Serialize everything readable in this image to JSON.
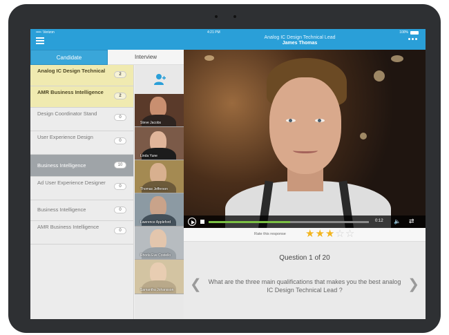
{
  "status": {
    "carrier": "••••◦ Verizon",
    "time": "4:21 PM",
    "battery": "100%"
  },
  "header": {
    "title": "Analog IC Design Technical Lead",
    "candidate": "James Thomas"
  },
  "tabs": [
    {
      "label": "Candidate"
    },
    {
      "label": "Interview"
    }
  ],
  "positions": [
    {
      "label": "Analog IC Design Technical",
      "count": "2"
    },
    {
      "label": "AMR Business Intelligence",
      "count": "2"
    },
    {
      "label": "Design Coordinator Stand",
      "count": "0"
    },
    {
      "label": "User Experience Design",
      "count": "0"
    },
    {
      "label": "Business Intelligence",
      "count": "10"
    },
    {
      "label": "Ad User Experience Designer",
      "count": "0"
    },
    {
      "label": "Business Intelligence",
      "count": "0"
    },
    {
      "label": "AMR Business Intelligence",
      "count": "0"
    }
  ],
  "candidates": [
    {
      "name": "Steve Jacobs"
    },
    {
      "name": "Linda Yune"
    },
    {
      "name": "Thomas Jefferson"
    },
    {
      "name": "Lawrence Appleford"
    },
    {
      "name": "Rhoda Eve Costello"
    },
    {
      "name": "Samantha Johansson"
    }
  ],
  "player": {
    "time": "0:12",
    "progress_percent": 51
  },
  "rating": {
    "label": "Rate this response",
    "value": 3,
    "max": 5
  },
  "question": {
    "counter": "Question 1 of 20",
    "text": "What are the three main qualifications that makes you the best analog IC Design Technical Lead ?"
  },
  "icons": {
    "prev": "chevron-left-icon",
    "next": "chevron-right-icon"
  }
}
